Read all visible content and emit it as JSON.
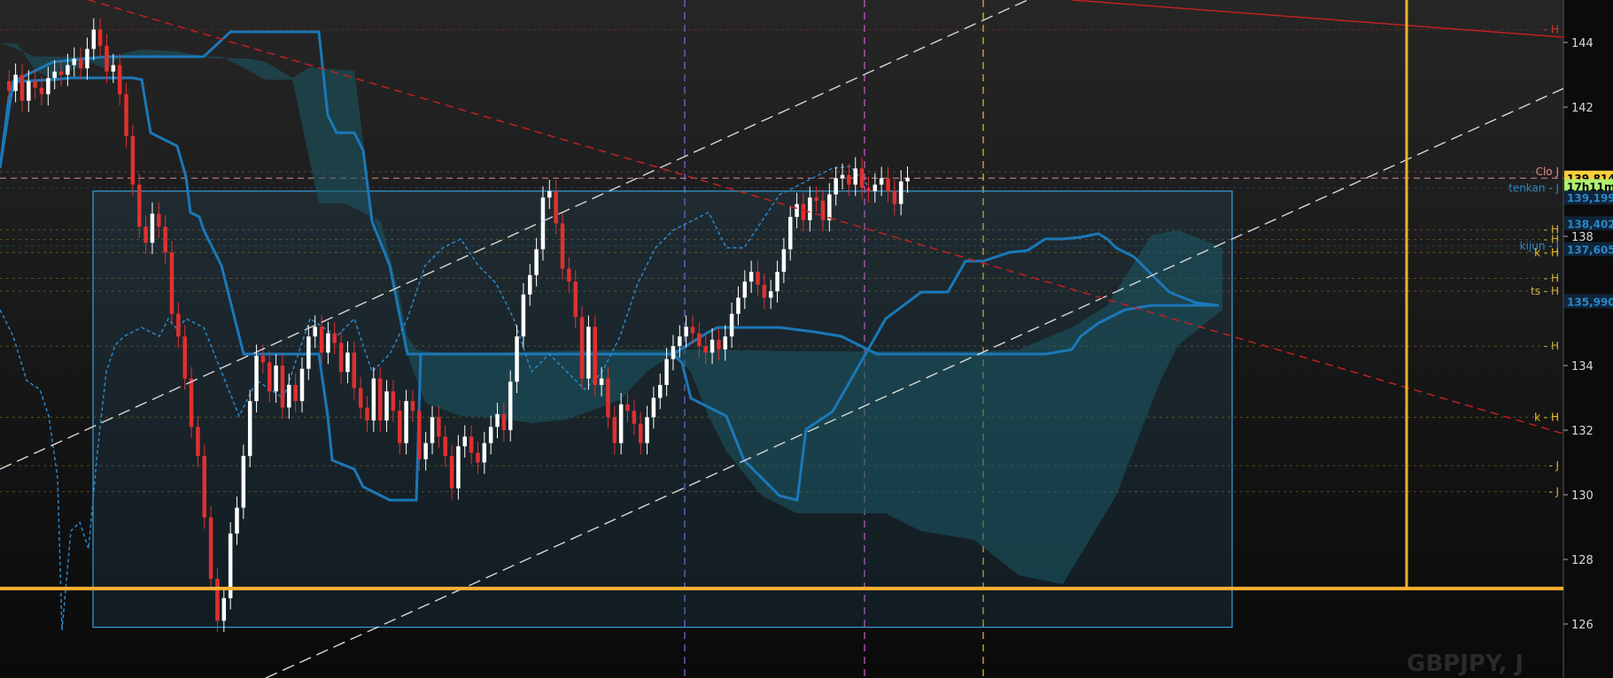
{
  "symbol_label": "GBPJPY, J",
  "colors": {
    "bull": "#ffffff",
    "bear": "#e03030",
    "kijun": "#1b78b8",
    "tenkan": "#2a88c8",
    "cloud": "#1c5a66",
    "channel": "#d8d8d8",
    "trend_red": "#c02020",
    "box": "#3aa0d8",
    "support": "#f7b030",
    "axis_bg": "#0b0b0b"
  },
  "chart_data": {
    "type": "candlestick",
    "y_range": [
      125,
      145
    ],
    "y_ticks": [
      "126",
      "128",
      "130",
      "132",
      "134",
      "136",
      "138",
      "140",
      "142",
      "144"
    ],
    "price_tags": [
      {
        "name": "last-price",
        "text": "139,814",
        "value": 139.814,
        "bg": "#f7d040",
        "fg": "#000000"
      },
      {
        "name": "countdown",
        "text": "17h11m",
        "value": 139.55,
        "bg": "#b0f070",
        "fg": "#000000"
      },
      {
        "name": "tenkan",
        "text": "139,199",
        "value": 139.199,
        "bg": "#10243a",
        "fg": "#2a88c8"
      },
      {
        "name": "kijun",
        "text": "138,402",
        "value": 138.402,
        "bg": "#10243a",
        "fg": "#2a88c8"
      },
      {
        "name": "senkou",
        "text": "137,605",
        "value": 137.605,
        "bg": "#10243a",
        "fg": "#2a88c8"
      },
      {
        "name": "chikou",
        "text": "135,990",
        "value": 135.99,
        "bg": "#10243a",
        "fg": "#2a88c8"
      }
    ],
    "level_labels": [
      {
        "text": "- H",
        "value": 144.4,
        "color": "#e03030"
      },
      {
        "text": "Clo J",
        "value": 140.0,
        "color": "#e08a8a"
      },
      {
        "text": "tenkan - J",
        "value": 139.5,
        "color": "#2a88c8"
      },
      {
        "text": "- H",
        "value": 138.2,
        "color": "#d0b040"
      },
      {
        "text": "- H",
        "value": 137.9,
        "color": "#d0b040"
      },
      {
        "text": "kijun - J",
        "value": 137.7,
        "color": "#2a88c8"
      },
      {
        "text": "k - H",
        "value": 137.5,
        "color": "#f0c020"
      },
      {
        "text": "- H",
        "value": 136.7,
        "color": "#d0b040"
      },
      {
        "text": "ts - H",
        "value": 136.3,
        "color": "#d0b040"
      },
      {
        "text": "- H",
        "value": 134.6,
        "color": "#d0b040"
      },
      {
        "text": "k - H",
        "value": 132.4,
        "color": "#f0c020"
      },
      {
        "text": "- J",
        "value": 130.9,
        "color": "#d0b040"
      },
      {
        "text": "- J",
        "value": 130.1,
        "color": "#d0b040"
      }
    ],
    "closes": [
      142.5,
      143.0,
      142.2,
      142.8,
      142.6,
      142.4,
      142.9,
      143.1,
      143.0,
      143.3,
      143.5,
      143.2,
      143.8,
      144.4,
      143.9,
      143.1,
      143.3,
      142.4,
      141.1,
      139.6,
      138.3,
      137.8,
      138.7,
      138.3,
      137.5,
      135.6,
      134.9,
      133.6,
      132.1,
      131.2,
      129.3,
      127.4,
      126.1,
      126.8,
      128.8,
      129.6,
      131.2,
      132.9,
      134.3,
      134.1,
      133.2,
      134.0,
      132.7,
      133.4,
      132.9,
      133.9,
      134.9,
      135.2,
      134.4,
      135.0,
      134.7,
      133.8,
      134.4,
      133.3,
      132.7,
      132.3,
      133.6,
      132.3,
      133.2,
      132.6,
      131.6,
      132.9,
      132.6,
      131.1,
      131.6,
      132.4,
      131.8,
      131.2,
      130.2,
      131.5,
      131.8,
      131.3,
      131.0,
      131.6,
      132.1,
      132.5,
      132.0,
      133.5,
      134.9,
      136.2,
      136.8,
      137.6,
      139.2,
      139.4,
      138.4,
      137.0,
      136.6,
      135.5,
      133.6,
      135.2,
      133.4,
      133.6,
      132.4,
      131.6,
      132.8,
      132.6,
      132.2,
      131.6,
      132.4,
      133.0,
      133.4,
      134.2,
      134.6,
      134.9,
      135.2,
      135.0,
      134.6,
      134.4,
      134.8,
      134.5,
      134.9,
      135.6,
      136.1,
      136.6,
      136.9,
      136.5,
      136.1,
      136.3,
      136.9,
      137.6,
      138.6,
      139.0,
      138.5,
      139.2,
      139.1,
      138.5,
      139.3,
      139.8,
      139.9,
      139.6,
      140.1,
      139.5,
      139.4,
      139.6,
      139.8,
      139.4,
      139.0,
      139.7,
      139.814
    ]
  }
}
